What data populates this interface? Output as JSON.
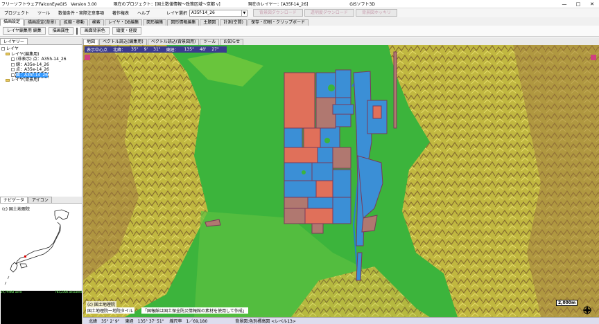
{
  "titlebar": {
    "app": "フリーソフトウェアFalconEyeGIS　Version 3.00",
    "project": "現在のプロジェクト：[国土数値情報～政策区域～京都 v]",
    "layer": "現在のレイヤー：[A35f-14_26]",
    "vendor": "GISソフト3D",
    "min": "—",
    "max": "□",
    "close": "✕"
  },
  "menu": {
    "items": [
      "プロジェクト",
      "ツール",
      "数値条件・実際注意事項",
      "著作権表",
      "ヘルプ"
    ],
    "layer_label": "レイヤ選択",
    "layer_value": "A35f-14_26",
    "buttons": [
      "背景図ダウンロード",
      "透明度ダウンロード",
      "背景図ホッキリ"
    ]
  },
  "main_tabs": [
    "描画設定",
    "描画設定(背景)",
    "拡縮・移動",
    "検索",
    "レイヤ・DB編集",
    "図形編集",
    "図形情報編集",
    "主題図",
    "計測(空間)",
    "保存・印刷・クリップボード"
  ],
  "ribbon": {
    "buttons": [
      "レイヤ編集用 編集",
      "描画属性",
      "画面背景色",
      "縦度・経度"
    ]
  },
  "left": {
    "tabs": [
      "レイヤリー"
    ],
    "tree": [
      {
        "label": "レイヤ",
        "indent": 0,
        "kind": "root"
      },
      {
        "label": "レイヤ(編集用)",
        "indent": 1,
        "kind": "folder"
      },
      {
        "label": "(非表示) 点：A35h-14_26",
        "indent": 2,
        "kind": "item"
      },
      {
        "label": "線：A35e-14_26",
        "indent": 2,
        "kind": "item"
      },
      {
        "label": "点：A35e-14_26",
        "indent": 2,
        "kind": "item"
      },
      {
        "label": "面：A35f-14_26",
        "indent": 2,
        "kind": "item",
        "selected": true
      },
      {
        "label": "レイヤ(背景用)",
        "indent": 1,
        "kind": "folder"
      }
    ],
    "nav_tabs": [
      "ナビゲータ",
      "アイコン"
    ],
    "nav_caption": "(c) 国土地理院",
    "mem_left": "29,794KB used",
    "mem_right": "783,236K allocated"
  },
  "map": {
    "tabs": [
      "地図",
      "ベクトル読込(編集用)",
      "ベクトル読込(背景図用)",
      "ツール",
      "お知らせ"
    ],
    "coord_toolbar": [
      "表示中心点",
      "北緯：",
      "35°",
      "9'",
      "31\"",
      "東経：",
      "135°",
      "48'",
      "27\""
    ],
    "credit1": "(c) 国土地理院",
    "credit2": "国土地理院一地院タイル",
    "credit3": "「国報館は国土保全防災情報館の素材を使用して作成」",
    "scale": "2,000m",
    "status": [
      "北緯　35° 2' 9\"",
      "東経　135° 37' 51\"",
      "縮尺率　1／69,180",
      "背景図:色別標高図 <レベル13>"
    ]
  },
  "colors": {
    "plain": "#3cb43c",
    "parcel_blue": "#3b8fd6",
    "parcel_red": "#e0705a",
    "parcel_brown": "#b07870",
    "outline": "#7a3a5a",
    "hill_yellow": "#d8c040",
    "hill_brown": "#a07840"
  }
}
